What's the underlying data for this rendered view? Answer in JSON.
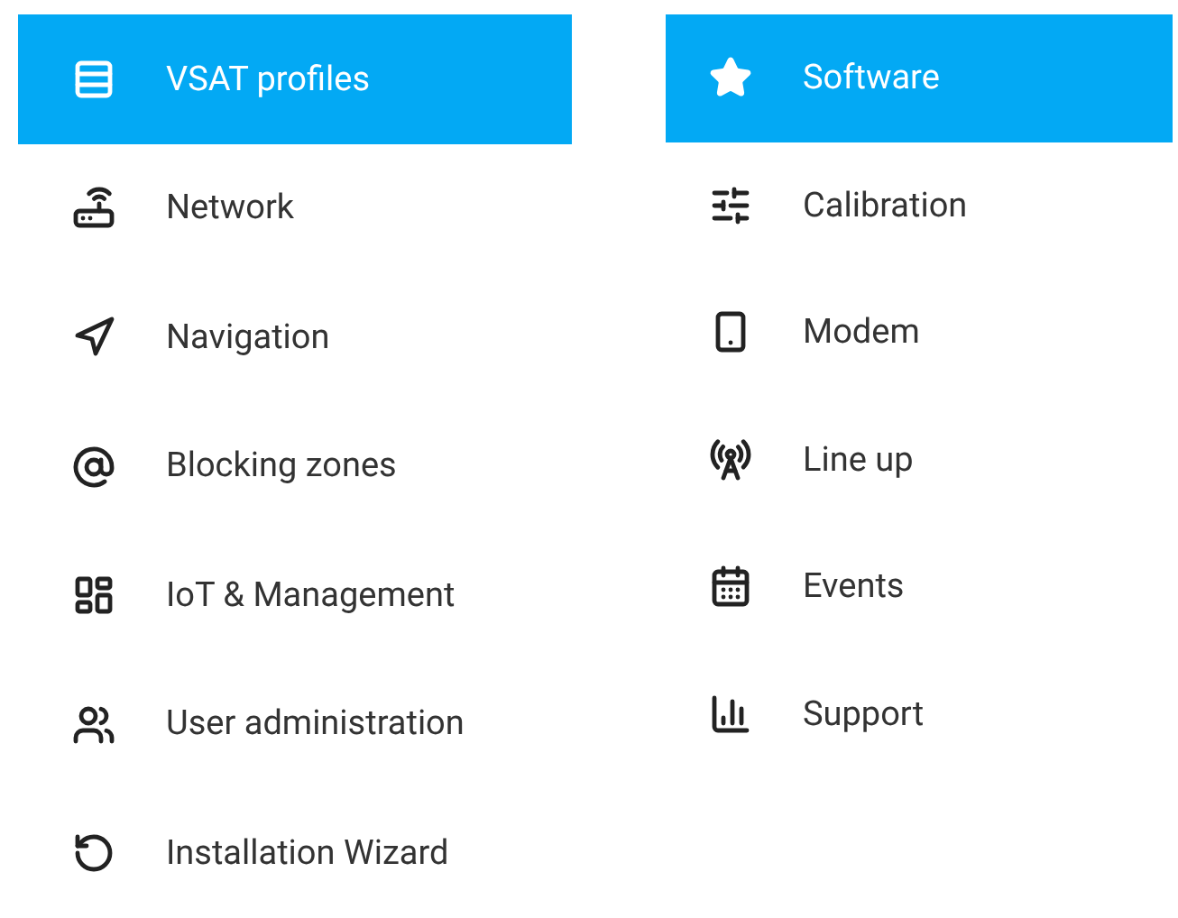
{
  "menus": [
    {
      "items": [
        {
          "label": "VSAT profiles",
          "selected": true
        },
        {
          "label": "Network",
          "selected": false
        },
        {
          "label": "Navigation",
          "selected": false
        },
        {
          "label": "Blocking zones",
          "selected": false
        },
        {
          "label": "IoT & Management",
          "selected": false
        },
        {
          "label": "User administration",
          "selected": false
        },
        {
          "label": "Installation Wizard",
          "selected": false
        }
      ]
    },
    {
      "items": [
        {
          "label": "Software",
          "selected": true
        },
        {
          "label": "Calibration",
          "selected": false
        },
        {
          "label": "Modem",
          "selected": false
        },
        {
          "label": "Line up",
          "selected": false
        },
        {
          "label": "Events",
          "selected": false
        },
        {
          "label": "Support",
          "selected": false
        }
      ]
    }
  ]
}
